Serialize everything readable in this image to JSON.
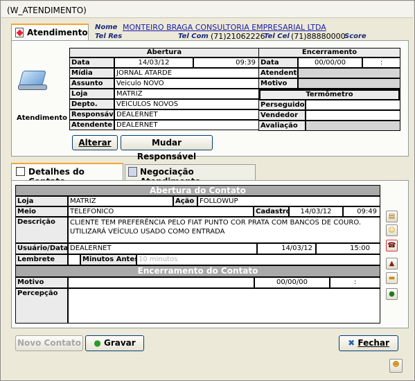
{
  "window": {
    "title": "(W_ATENDIMENTO)"
  },
  "header": {
    "tab_label": "Atendimento",
    "nome_label": "Nome",
    "nome_value": "MONTEIRO BRAGA CONSULTORIA EMPRESARIAL LTDA",
    "telres_label": "Tel Res",
    "telcom_label": "Tel Com",
    "telcom_value": "(71)21062226",
    "telcel_label": "Tel Cel",
    "telcel_value": "(71)88880000",
    "score_label": "Score"
  },
  "atendimento": {
    "icon_caption": "Atendimento",
    "abertura_header": "Abertura",
    "encerramento_header": "Encerramento",
    "rows": {
      "data": {
        "label": "Data",
        "date": "14/03/12",
        "time": "09:39"
      },
      "midia": {
        "label": "Mídia",
        "value": "JORNAL ATARDE"
      },
      "assunto": {
        "label": "Assunto",
        "value": "Veiculo NOVO"
      },
      "loja": {
        "label": "Loja",
        "value": "MATRIZ"
      },
      "depto": {
        "label": "Depto.",
        "value": "VEICULOS NOVOS"
      },
      "responsavel": {
        "label": "Responsável",
        "value": "DEALERNET"
      },
      "atendente": {
        "label": "Atendente",
        "value": "DEALERNET"
      }
    },
    "enc": {
      "data_label": "Data",
      "data_date": "00/00/00",
      "data_time": ":",
      "atendente_label": "Atendente",
      "motivo_label": "Motivo",
      "termometro_header": "Termômetro",
      "perseguidor_label": "Perseguidor",
      "vendedor_label": "Vendedor",
      "avaliacao_label": "Avaliação"
    },
    "buttons": {
      "alterar": "Alterar",
      "mudar": "Mudar Responsável"
    }
  },
  "tabs": [
    {
      "label": "Detalhes do Contato"
    },
    {
      "label": "Negociação Atendimento"
    }
  ],
  "contato": {
    "abertura_header": "Abertura do Contato",
    "loja_label": "Loja",
    "loja_value": "MATRIZ",
    "acao_label": "Ação",
    "acao_value": "FOLLOWUP",
    "meio_label": "Meio",
    "meio_value": "TELEFONICO",
    "cadastro_label": "Cadastro",
    "cadastro_date": "14/03/12",
    "cadastro_time": "09:49",
    "descricao_label": "Descrição",
    "descricao_value": "CLIENTE TEM PREFERÊNCIA PELO FIAT PUNTO COR PRATA COM BANCOS DE COURO. UTILIZARÁ VEÍCULO USADO COMO ENTRADA",
    "usuario_label": "Usuário/Data",
    "usuario_value": "DEALERNET",
    "usuario_date": "14/03/12",
    "usuario_time": "15:00",
    "lembrete_label": "Lembrete",
    "minutos_label": "Minutos Antes",
    "minutos_placeholder": "10 minutos",
    "encerramento_header": "Encerramento do Contato",
    "motivo_label": "Motivo",
    "motivo_date": "00/00/00",
    "motivo_time": ":",
    "percepcao_label": "Percepção"
  },
  "footer": {
    "novo": "Novo Contato",
    "gravar": "Gravar",
    "fechar": "Fechar"
  },
  "colors": {
    "title_bar": "#f4f3ee",
    "grid_gray": "#a9a9a9",
    "tab_accent": "#f7a333",
    "link_blue": "#1a1aa8"
  }
}
